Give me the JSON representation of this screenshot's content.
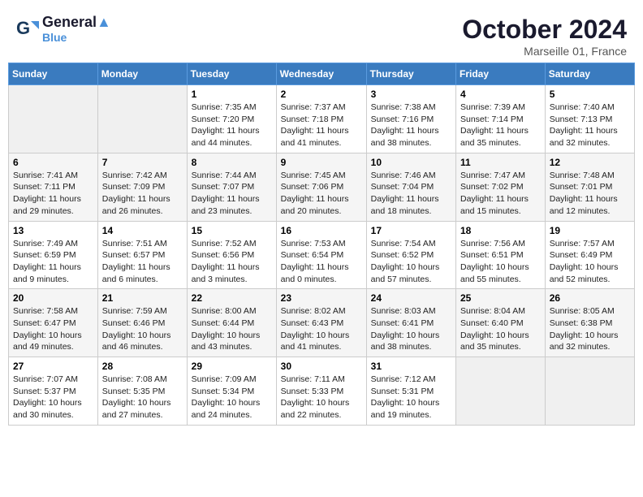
{
  "logo": {
    "line1": "General",
    "line2": "Blue"
  },
  "title": "October 2024",
  "location": "Marseille 01, France",
  "weekdays": [
    "Sunday",
    "Monday",
    "Tuesday",
    "Wednesday",
    "Thursday",
    "Friday",
    "Saturday"
  ],
  "weeks": [
    [
      {
        "day": "",
        "sunrise": "",
        "sunset": "",
        "daylight": ""
      },
      {
        "day": "",
        "sunrise": "",
        "sunset": "",
        "daylight": ""
      },
      {
        "day": "1",
        "sunrise": "Sunrise: 7:35 AM",
        "sunset": "Sunset: 7:20 PM",
        "daylight": "Daylight: 11 hours and 44 minutes."
      },
      {
        "day": "2",
        "sunrise": "Sunrise: 7:37 AM",
        "sunset": "Sunset: 7:18 PM",
        "daylight": "Daylight: 11 hours and 41 minutes."
      },
      {
        "day": "3",
        "sunrise": "Sunrise: 7:38 AM",
        "sunset": "Sunset: 7:16 PM",
        "daylight": "Daylight: 11 hours and 38 minutes."
      },
      {
        "day": "4",
        "sunrise": "Sunrise: 7:39 AM",
        "sunset": "Sunset: 7:14 PM",
        "daylight": "Daylight: 11 hours and 35 minutes."
      },
      {
        "day": "5",
        "sunrise": "Sunrise: 7:40 AM",
        "sunset": "Sunset: 7:13 PM",
        "daylight": "Daylight: 11 hours and 32 minutes."
      }
    ],
    [
      {
        "day": "6",
        "sunrise": "Sunrise: 7:41 AM",
        "sunset": "Sunset: 7:11 PM",
        "daylight": "Daylight: 11 hours and 29 minutes."
      },
      {
        "day": "7",
        "sunrise": "Sunrise: 7:42 AM",
        "sunset": "Sunset: 7:09 PM",
        "daylight": "Daylight: 11 hours and 26 minutes."
      },
      {
        "day": "8",
        "sunrise": "Sunrise: 7:44 AM",
        "sunset": "Sunset: 7:07 PM",
        "daylight": "Daylight: 11 hours and 23 minutes."
      },
      {
        "day": "9",
        "sunrise": "Sunrise: 7:45 AM",
        "sunset": "Sunset: 7:06 PM",
        "daylight": "Daylight: 11 hours and 20 minutes."
      },
      {
        "day": "10",
        "sunrise": "Sunrise: 7:46 AM",
        "sunset": "Sunset: 7:04 PM",
        "daylight": "Daylight: 11 hours and 18 minutes."
      },
      {
        "day": "11",
        "sunrise": "Sunrise: 7:47 AM",
        "sunset": "Sunset: 7:02 PM",
        "daylight": "Daylight: 11 hours and 15 minutes."
      },
      {
        "day": "12",
        "sunrise": "Sunrise: 7:48 AM",
        "sunset": "Sunset: 7:01 PM",
        "daylight": "Daylight: 11 hours and 12 minutes."
      }
    ],
    [
      {
        "day": "13",
        "sunrise": "Sunrise: 7:49 AM",
        "sunset": "Sunset: 6:59 PM",
        "daylight": "Daylight: 11 hours and 9 minutes."
      },
      {
        "day": "14",
        "sunrise": "Sunrise: 7:51 AM",
        "sunset": "Sunset: 6:57 PM",
        "daylight": "Daylight: 11 hours and 6 minutes."
      },
      {
        "day": "15",
        "sunrise": "Sunrise: 7:52 AM",
        "sunset": "Sunset: 6:56 PM",
        "daylight": "Daylight: 11 hours and 3 minutes."
      },
      {
        "day": "16",
        "sunrise": "Sunrise: 7:53 AM",
        "sunset": "Sunset: 6:54 PM",
        "daylight": "Daylight: 11 hours and 0 minutes."
      },
      {
        "day": "17",
        "sunrise": "Sunrise: 7:54 AM",
        "sunset": "Sunset: 6:52 PM",
        "daylight": "Daylight: 10 hours and 57 minutes."
      },
      {
        "day": "18",
        "sunrise": "Sunrise: 7:56 AM",
        "sunset": "Sunset: 6:51 PM",
        "daylight": "Daylight: 10 hours and 55 minutes."
      },
      {
        "day": "19",
        "sunrise": "Sunrise: 7:57 AM",
        "sunset": "Sunset: 6:49 PM",
        "daylight": "Daylight: 10 hours and 52 minutes."
      }
    ],
    [
      {
        "day": "20",
        "sunrise": "Sunrise: 7:58 AM",
        "sunset": "Sunset: 6:47 PM",
        "daylight": "Daylight: 10 hours and 49 minutes."
      },
      {
        "day": "21",
        "sunrise": "Sunrise: 7:59 AM",
        "sunset": "Sunset: 6:46 PM",
        "daylight": "Daylight: 10 hours and 46 minutes."
      },
      {
        "day": "22",
        "sunrise": "Sunrise: 8:00 AM",
        "sunset": "Sunset: 6:44 PM",
        "daylight": "Daylight: 10 hours and 43 minutes."
      },
      {
        "day": "23",
        "sunrise": "Sunrise: 8:02 AM",
        "sunset": "Sunset: 6:43 PM",
        "daylight": "Daylight: 10 hours and 41 minutes."
      },
      {
        "day": "24",
        "sunrise": "Sunrise: 8:03 AM",
        "sunset": "Sunset: 6:41 PM",
        "daylight": "Daylight: 10 hours and 38 minutes."
      },
      {
        "day": "25",
        "sunrise": "Sunrise: 8:04 AM",
        "sunset": "Sunset: 6:40 PM",
        "daylight": "Daylight: 10 hours and 35 minutes."
      },
      {
        "day": "26",
        "sunrise": "Sunrise: 8:05 AM",
        "sunset": "Sunset: 6:38 PM",
        "daylight": "Daylight: 10 hours and 32 minutes."
      }
    ],
    [
      {
        "day": "27",
        "sunrise": "Sunrise: 7:07 AM",
        "sunset": "Sunset: 5:37 PM",
        "daylight": "Daylight: 10 hours and 30 minutes."
      },
      {
        "day": "28",
        "sunrise": "Sunrise: 7:08 AM",
        "sunset": "Sunset: 5:35 PM",
        "daylight": "Daylight: 10 hours and 27 minutes."
      },
      {
        "day": "29",
        "sunrise": "Sunrise: 7:09 AM",
        "sunset": "Sunset: 5:34 PM",
        "daylight": "Daylight: 10 hours and 24 minutes."
      },
      {
        "day": "30",
        "sunrise": "Sunrise: 7:11 AM",
        "sunset": "Sunset: 5:33 PM",
        "daylight": "Daylight: 10 hours and 22 minutes."
      },
      {
        "day": "31",
        "sunrise": "Sunrise: 7:12 AM",
        "sunset": "Sunset: 5:31 PM",
        "daylight": "Daylight: 10 hours and 19 minutes."
      },
      {
        "day": "",
        "sunrise": "",
        "sunset": "",
        "daylight": ""
      },
      {
        "day": "",
        "sunrise": "",
        "sunset": "",
        "daylight": ""
      }
    ]
  ]
}
